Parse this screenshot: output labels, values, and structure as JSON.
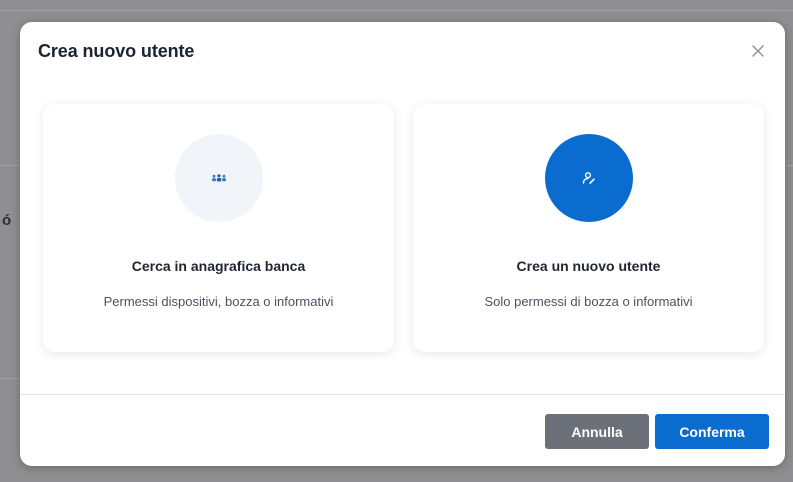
{
  "dialog": {
    "title": "Crea nuovo utente",
    "close_icon": "close-icon"
  },
  "options": [
    {
      "icon": "people-group-icon",
      "title": "Cerca in anagrafica banca",
      "subtitle": "Permessi dispositivi, bozza o informativi",
      "selected": false
    },
    {
      "icon": "user-edit-icon",
      "title": "Crea un nuovo utente",
      "subtitle": "Solo permessi di bozza o informativi",
      "selected": true
    }
  ],
  "footer": {
    "cancel_label": "Annulla",
    "confirm_label": "Conferma"
  },
  "colors": {
    "accent": "#0b6cd0",
    "cancel": "#6b7079",
    "overlay": "#8f8f91",
    "icon_bg_light": "#f1f4f9"
  }
}
